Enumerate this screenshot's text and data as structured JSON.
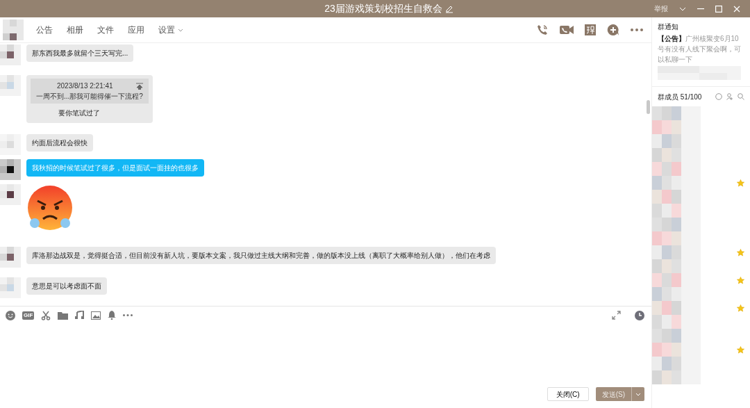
{
  "window": {
    "title": "23届游戏策划校招生自救会",
    "report": "举报"
  },
  "tabs": [
    {
      "label": "公告",
      "dropdown": false
    },
    {
      "label": "相册",
      "dropdown": false
    },
    {
      "label": "文件",
      "dropdown": false
    },
    {
      "label": "应用",
      "dropdown": false
    },
    {
      "label": "设置",
      "dropdown": true
    }
  ],
  "messages": [
    {
      "kind": "text",
      "own": false,
      "text": "那东西我最多就留个三天写完..."
    },
    {
      "kind": "quote",
      "own": false,
      "quote_time": "2023/8/13 2:21:41",
      "quote_text": "一周不到...那我可能得催一下流程?",
      "text": "要你笔试过了"
    },
    {
      "kind": "text",
      "own": false,
      "text": "约面后流程会很快"
    },
    {
      "kind": "text",
      "own": true,
      "text": "我秋招的时候笔试过了很多，但是面试一面挂的也很多"
    },
    {
      "kind": "sticker"
    },
    {
      "kind": "text",
      "own": false,
      "text": "库洛那边战双是，觉得挺合适，但目前没有新人坑，要版本文案，我只做过主线大纲和完善，做的版本没上线（离职了大概率给别人做），他们在考虑"
    },
    {
      "kind": "text",
      "own": false,
      "text": "意思是可以考虑面不面"
    }
  ],
  "input_toolbar": {
    "gif_label": "GIF"
  },
  "buttons": {
    "close": "关闭(C)",
    "send": "发送(S)"
  },
  "notice": {
    "title": "群通知",
    "tag": "【公告】",
    "text": "广州核聚变6月10号有没有人线下聚会啊，可以私聊一下"
  },
  "members": {
    "title": "群成员 51/100",
    "rows": [
      {
        "admin": false
      },
      {
        "admin": false
      },
      {
        "admin": false
      },
      {
        "admin": false
      },
      {
        "admin": false
      },
      {
        "admin": true
      },
      {
        "admin": false
      },
      {
        "admin": false
      },
      {
        "admin": false
      },
      {
        "admin": false
      },
      {
        "admin": true
      },
      {
        "admin": false
      },
      {
        "admin": true
      },
      {
        "admin": false
      },
      {
        "admin": true
      },
      {
        "admin": false
      },
      {
        "admin": false
      },
      {
        "admin": true
      },
      {
        "admin": false
      },
      {
        "admin": false
      }
    ]
  }
}
